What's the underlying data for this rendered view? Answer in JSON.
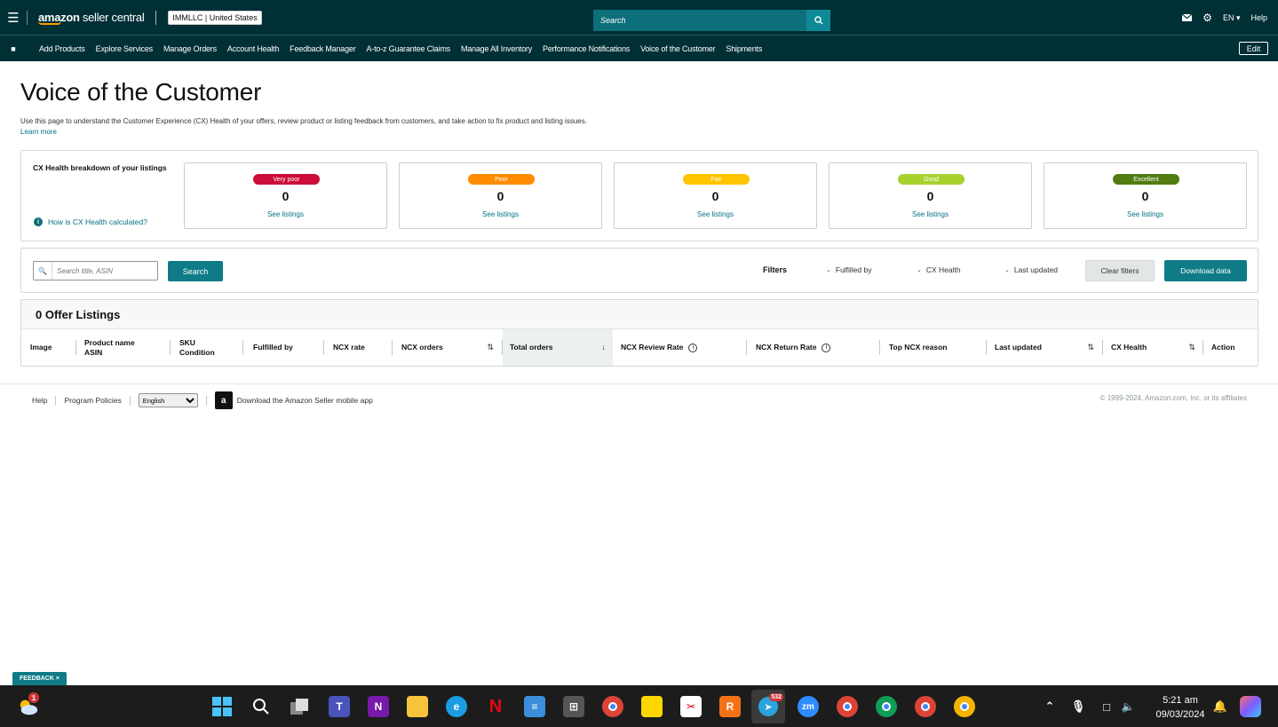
{
  "topbar": {
    "logo_main": "amazon",
    "logo_rest": " seller central",
    "account": "IMMLLC | United States",
    "search_placeholder": "Search",
    "language": "EN",
    "help": "Help"
  },
  "nav": {
    "items": [
      "Add Products",
      "Explore Services",
      "Manage Orders",
      "Account Health",
      "Feedback Manager",
      "A-to-z Guarantee Claims",
      "Manage All Inventory",
      "Performance Notifications",
      "Voice of the Customer",
      "Shipments"
    ],
    "edit": "Edit"
  },
  "page": {
    "title": "Voice of the Customer",
    "description": "Use this page to understand the Customer Experience (CX) Health of your offers, review product or listing feedback from customers, and take action to fix product and listing issues.",
    "learn_more": "Learn more"
  },
  "cx": {
    "title": "CX Health breakdown of your listings",
    "how_link": "How is CX Health calculated?",
    "cards": [
      {
        "label": "Very poor",
        "count": "0",
        "link": "See listings",
        "color": "#cc0c39"
      },
      {
        "label": "Poor",
        "count": "0",
        "link": "See listings",
        "color": "#ff8c00"
      },
      {
        "label": "Fair",
        "count": "0",
        "link": "See listings",
        "color": "#ffc400"
      },
      {
        "label": "Good",
        "count": "0",
        "link": "See listings",
        "color": "#a9d12d"
      },
      {
        "label": "Excellent",
        "count": "0",
        "link": "See listings",
        "color": "#507c12"
      }
    ]
  },
  "filters": {
    "search_placeholder": "Search title, ASIN",
    "search_button": "Search",
    "filters_label": "Filters",
    "fulfilled_by": "Fulfilled by",
    "cx_health": "CX Health",
    "last_updated": "Last updated",
    "clear": "Clear filters",
    "download": "Download data"
  },
  "table": {
    "title": "0 Offer Listings",
    "columns": {
      "image": "Image",
      "product_name": "Product name",
      "asin": "ASIN",
      "sku": "SKU",
      "condition": "Condition",
      "fulfilled_by": "Fulfilled by",
      "ncx_rate": "NCX rate",
      "ncx_orders": "NCX orders",
      "total_orders": "Total orders",
      "ncx_review_rate": "NCX Review Rate",
      "ncx_return_rate": "NCX Return Rate",
      "top_ncx_reason": "Top NCX reason",
      "last_updated": "Last updated",
      "cx_health": "CX Health",
      "action": "Action"
    }
  },
  "footer": {
    "help": "Help",
    "policies": "Program Policies",
    "language": "English",
    "app": "Download the Amazon Seller mobile app",
    "copyright": "© 1999-2024, Amazon.com, Inc. or its affiliates",
    "feedback": "FEEDBACK"
  },
  "taskbar": {
    "weather_badge": "1",
    "telegram_badge": "532",
    "time": "5:21 am",
    "date": "09/03/2024"
  }
}
